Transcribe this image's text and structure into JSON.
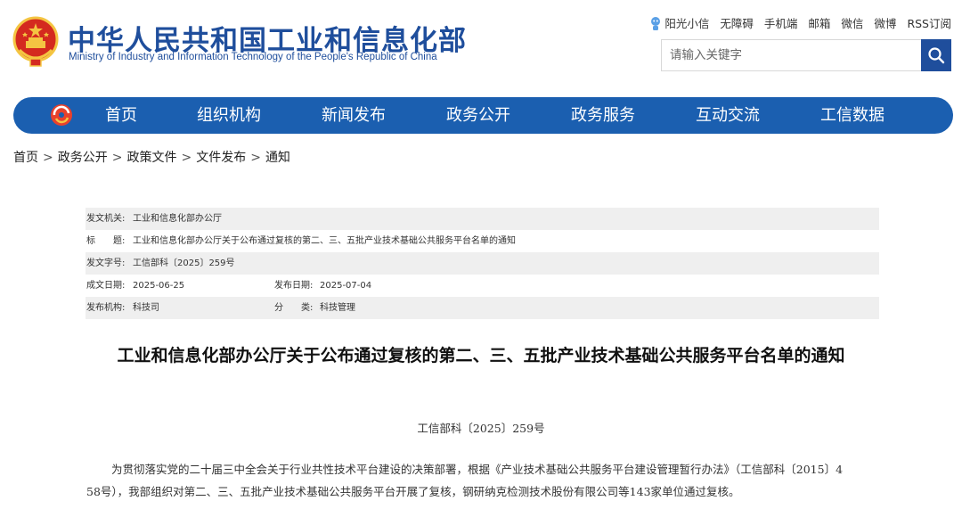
{
  "header": {
    "site_title": "中华人民共和国工业和信息化部",
    "site_subtitle": "Ministry of Industry and Information Technology of the People's Republic of China",
    "toplinks": [
      "阳光小信",
      "无障碍",
      "手机端",
      "邮箱",
      "微信",
      "微博",
      "RSS订阅"
    ],
    "search_placeholder": "请输入关键字"
  },
  "nav": {
    "items": [
      "首页",
      "组织机构",
      "新闻发布",
      "政务公开",
      "政务服务",
      "互动交流",
      "工信数据"
    ]
  },
  "breadcrumb": [
    "首页",
    "政务公开",
    "政策文件",
    "文件发布",
    "通知"
  ],
  "meta": {
    "issuer_label": "发文机关:",
    "issuer": "工业和信息化部办公厅",
    "title_label": "标　　题:",
    "title": "工业和信息化部办公厅关于公布通过复核的第二、三、五批产业技术基础公共服务平台名单的通知",
    "docno_label": "发文字号:",
    "docno": "工信部科〔2025〕259号",
    "created_label": "成文日期:",
    "created": "2025-06-25",
    "published_label": "发布日期:",
    "published": "2025-07-04",
    "org_label": "发布机构:",
    "org": "科技司",
    "category_label": "分　　类:",
    "category": "科技管理"
  },
  "article": {
    "title": "工业和信息化部办公厅关于公布通过复核的第二、三、五批产业技术基础公共服务平台名单的通知",
    "doc_number": "工信部科〔2025〕259号",
    "para_line1": "为贯彻落实党的二十届三中全会关于行业共性技术平台建设的决策部署，根据《产业技术基础公共服务平台建设管理暂行办法》（工信部科〔2015〕4",
    "para_line2": "58号），我部组织对第二、三、五批产业技术基础公共服务平台开展了复核，钢研纳克检测技术股份有限公司等143家单位通过复核。"
  },
  "colors": {
    "brand_blue": "#1f4e9c",
    "nav_blue": "#1b5fb0",
    "emblem_red": "#d42a1f",
    "emblem_gold": "#f4c542"
  }
}
